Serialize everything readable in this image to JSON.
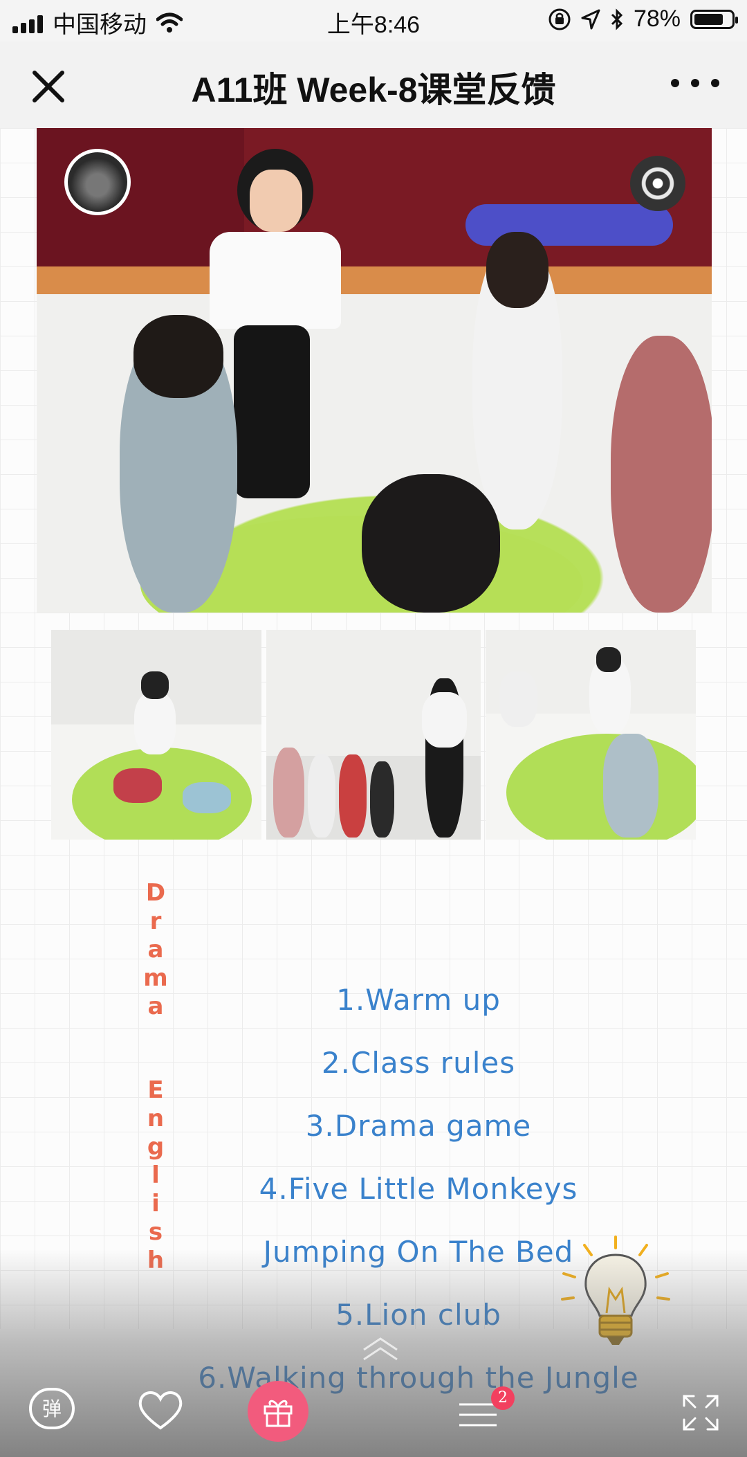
{
  "status_bar": {
    "carrier": "中国移动",
    "time": "上午8:46",
    "battery_percent": "78%",
    "battery_level": 0.78
  },
  "nav": {
    "title": "A11班 Week-8课堂反馈"
  },
  "sidebar_text": {
    "word1": [
      "D",
      "r",
      "a",
      "m",
      "a"
    ],
    "word2": [
      "E",
      "n",
      "g",
      "l",
      "i",
      "s",
      "h"
    ]
  },
  "lesson_items": [
    "1.Warm up",
    "2.Class rules",
    "3.Drama game",
    "4.Five Little Monkeys",
    "Jumping On The Bed",
    "5.Lion club",
    "6.Walking through the Jungle"
  ],
  "bottom_bar": {
    "barrage_label": "弹",
    "menu_badge": "2"
  },
  "colors": {
    "lesson_text": "#3a82cc",
    "drama_text": "#ea6a4e",
    "gift_button": "#f25b7d",
    "badge": "#f2405f"
  },
  "icons": [
    "close-icon",
    "more-icon",
    "music-disc-icon",
    "lightbulb-icon",
    "heart-icon",
    "gift-icon",
    "menu-icon",
    "fullscreen-icon",
    "scroll-up-icon"
  ]
}
